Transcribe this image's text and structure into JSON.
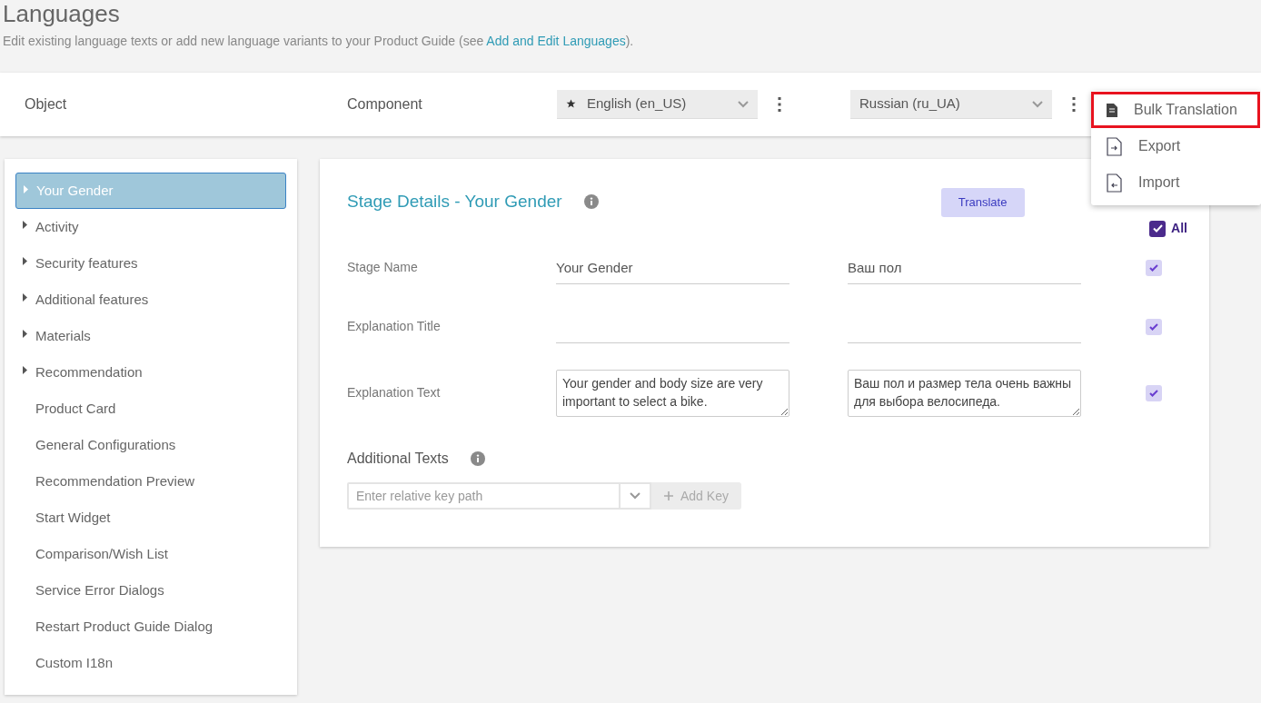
{
  "page": {
    "title": "Languages",
    "description_before": "Edit existing language texts or add new language variants to your Product Guide (see ",
    "link": "Add and Edit Languages",
    "description_after": ")."
  },
  "header": {
    "column_1": "Object",
    "column_2": "Component",
    "languages": [
      {
        "label": "English (en_US)",
        "default": true
      },
      {
        "label": "Russian (ru_UA)",
        "default": false
      }
    ]
  },
  "menu": [
    {
      "label": "Bulk Translation",
      "highlighted": true
    },
    {
      "label": "Export",
      "highlighted": false
    },
    {
      "label": "Import",
      "highlighted": false
    }
  ],
  "sidebar": {
    "items": [
      {
        "label": "Your Gender",
        "kind": "group",
        "selected": true
      },
      {
        "label": "Activity",
        "kind": "group",
        "selected": false
      },
      {
        "label": "Security features",
        "kind": "group",
        "selected": false
      },
      {
        "label": "Additional features",
        "kind": "group",
        "selected": false
      },
      {
        "label": "Materials",
        "kind": "group",
        "selected": false
      },
      {
        "label": "Recommendation",
        "kind": "group",
        "selected": false
      },
      {
        "label": "Product Card",
        "kind": "leaf",
        "selected": false
      },
      {
        "label": "General Configurations",
        "kind": "leaf",
        "selected": false
      },
      {
        "label": "Recommendation Preview",
        "kind": "leaf",
        "selected": false
      },
      {
        "label": "Start Widget",
        "kind": "leaf",
        "selected": false
      },
      {
        "label": "Comparison/Wish List",
        "kind": "leaf",
        "selected": false
      },
      {
        "label": "Service Error Dialogs",
        "kind": "leaf",
        "selected": false
      },
      {
        "label": "Restart Product Guide Dialog",
        "kind": "leaf",
        "selected": false
      },
      {
        "label": "Custom I18n",
        "kind": "leaf",
        "selected": false
      }
    ]
  },
  "details": {
    "title": "Stage Details - Your Gender",
    "translate_button": "Translate",
    "all_label": "All",
    "all_checked": true,
    "fields": [
      {
        "label": "Stage Name",
        "kind": "line",
        "source": "Your Gender",
        "target": "Ваш пол",
        "checked": true
      },
      {
        "label": "Explanation Title",
        "kind": "line",
        "checked": true
      },
      {
        "label": "Explanation Text",
        "kind": "area",
        "source": "Your gender and body size are very important to select a bike.",
        "target": "Ваш пол и размер тела очень важны для выбора велосипеда.",
        "checked": true
      }
    ],
    "additional_title": "Additional Texts",
    "key_placeholder": "Enter relative key path",
    "add_key_button": "Add Key"
  }
}
